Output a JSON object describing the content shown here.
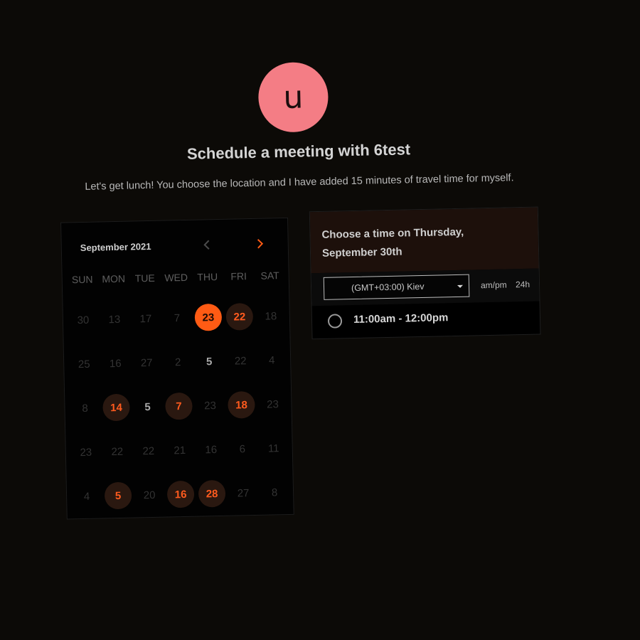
{
  "host": {
    "avatar_letter": "u",
    "avatar_color": "#f47d85",
    "title": "Schedule a meeting with 6test",
    "description": "Let's get lunch! You choose the location and I have added 15 minutes of travel time for myself."
  },
  "calendar": {
    "month_label": "September 2021",
    "prev_icon": "chevron-left-icon",
    "next_icon": "chevron-right-icon",
    "weekdays": [
      "SUN",
      "MON",
      "TUE",
      "WED",
      "THU",
      "FRI",
      "SAT"
    ],
    "days": [
      {
        "label": "30",
        "state": "muted"
      },
      {
        "label": "13",
        "state": "muted"
      },
      {
        "label": "17",
        "state": "muted"
      },
      {
        "label": "7",
        "state": "muted"
      },
      {
        "label": "23",
        "state": "selected"
      },
      {
        "label": "22",
        "state": "open"
      },
      {
        "label": "18",
        "state": "muted"
      },
      {
        "label": "25",
        "state": "muted"
      },
      {
        "label": "16",
        "state": "muted"
      },
      {
        "label": "27",
        "state": "muted"
      },
      {
        "label": "2",
        "state": "muted"
      },
      {
        "label": "5",
        "state": "plain"
      },
      {
        "label": "22",
        "state": "muted"
      },
      {
        "label": "4",
        "state": "muted"
      },
      {
        "label": "8",
        "state": "muted"
      },
      {
        "label": "14",
        "state": "open"
      },
      {
        "label": "5",
        "state": "plain"
      },
      {
        "label": "7",
        "state": "open"
      },
      {
        "label": "23",
        "state": "muted"
      },
      {
        "label": "18",
        "state": "open"
      },
      {
        "label": "23",
        "state": "muted"
      },
      {
        "label": "23",
        "state": "muted"
      },
      {
        "label": "22",
        "state": "muted"
      },
      {
        "label": "22",
        "state": "muted"
      },
      {
        "label": "21",
        "state": "muted"
      },
      {
        "label": "16",
        "state": "muted"
      },
      {
        "label": "6",
        "state": "muted"
      },
      {
        "label": "11",
        "state": "muted"
      },
      {
        "label": "4",
        "state": "muted"
      },
      {
        "label": "5",
        "state": "open"
      },
      {
        "label": "20",
        "state": "muted"
      },
      {
        "label": "16",
        "state": "open"
      },
      {
        "label": "28",
        "state": "open"
      },
      {
        "label": "27",
        "state": "muted"
      },
      {
        "label": "8",
        "state": "muted"
      }
    ]
  },
  "time_panel": {
    "heading": "Choose a time on Thursday, September 30th",
    "timezone": "(GMT+03:00) Kiev",
    "format_ampm": "am/pm",
    "format_24h": "24h",
    "slots": [
      "11:00am - 12:00pm"
    ]
  },
  "colors": {
    "accent": "#ff5b14",
    "background": "#0c0a07"
  }
}
